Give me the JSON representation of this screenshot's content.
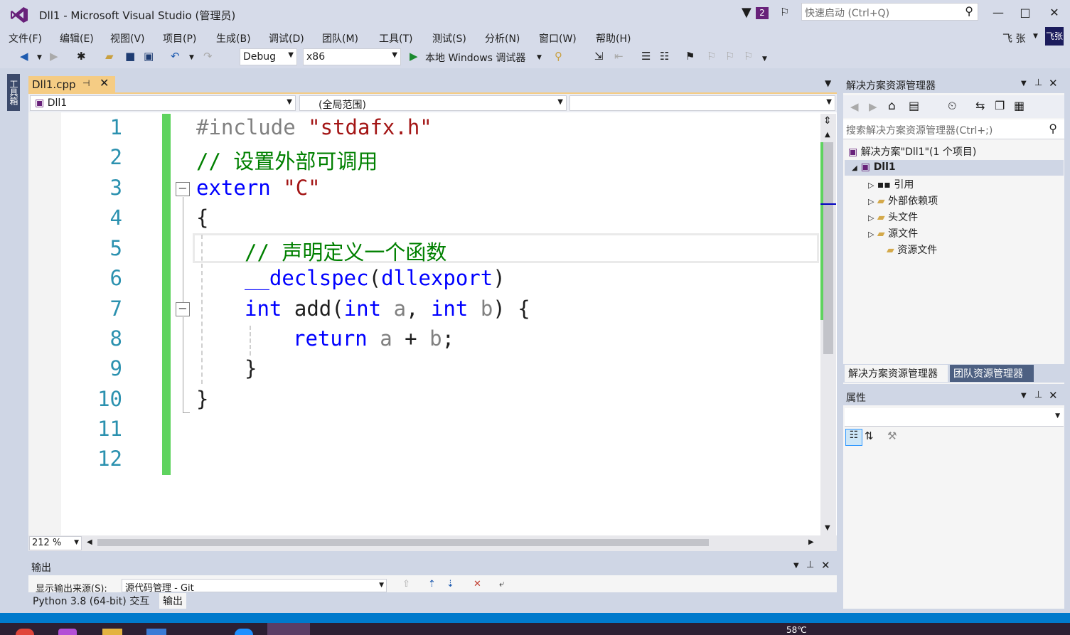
{
  "window": {
    "title": "Dll1 - Microsoft Visual Studio (管理员)",
    "notification_count": "2",
    "quick_launch_placeholder": "快速启动 (Ctrl+Q)",
    "user_name": "飞 张",
    "user_avatar_text": "飞张"
  },
  "menu": [
    "文件(F)",
    "编辑(E)",
    "视图(V)",
    "项目(P)",
    "生成(B)",
    "调试(D)",
    "团队(M)",
    "工具(T)",
    "测试(S)",
    "分析(N)",
    "窗口(W)",
    "帮助(H)"
  ],
  "toolbar": {
    "config": "Debug",
    "platform": "x86",
    "run_label": "本地 Windows 调试器"
  },
  "toolbox_tab": "工具箱",
  "editor": {
    "tab": "Dll1.cpp",
    "nav_project": "Dll1",
    "nav_scope": "(全局范围)",
    "nav_member": "",
    "zoom": "212 %",
    "line_numbers": [
      "1",
      "2",
      "3",
      "4",
      "5",
      "6",
      "7",
      "8",
      "9",
      "10",
      "11",
      "12"
    ],
    "code": {
      "l1_directive": "#include",
      "l1_string": "\"stdafx.h\"",
      "l2_comment": "// 设置外部可调用",
      "l3_keyword": "extern",
      "l3_string": "\"C\"",
      "l4": "{",
      "l5_comment": "// 声明定义一个函数",
      "l6_keyword": "__declspec",
      "l6_open": "(",
      "l6_arg": "dllexport",
      "l6_close": ")",
      "l7_int1": "int",
      "l7_name": "add(",
      "l7_int2": "int",
      "l7_a": "a",
      "l7_comma": ",",
      "l7_int3": "int",
      "l7_b": "b",
      "l7_close": ")",
      "l7_brace": "{",
      "l8_return": "return",
      "l8_a": "a",
      "l8_plus": "+",
      "l8_b": "b",
      "l8_semi": ";",
      "l9": "}",
      "l10": "}"
    }
  },
  "solution_explorer": {
    "title": "解决方案资源管理器",
    "search_placeholder": "搜索解决方案资源管理器(Ctrl+;)",
    "solution": "解决方案\"Dll1\"(1 个项目)",
    "project": "Dll1",
    "items": [
      "引用",
      "外部依赖项",
      "头文件",
      "源文件",
      "资源文件"
    ],
    "tabs": [
      "解决方案资源管理器",
      "团队资源管理器"
    ]
  },
  "properties": {
    "title": "属性"
  },
  "output": {
    "title": "输出",
    "source_label": "显示输出来源(S):",
    "source_value": "源代码管理 - Git",
    "tabs": [
      "Python 3.8 (64-bit) 交互",
      "输出"
    ]
  },
  "taskbar": {
    "temperature": "58℃"
  },
  "colors": {
    "accent": "#68217a",
    "tab_active": "#f5cc84",
    "change_bar": "#5fd35f",
    "status_bar": "#007acc"
  }
}
